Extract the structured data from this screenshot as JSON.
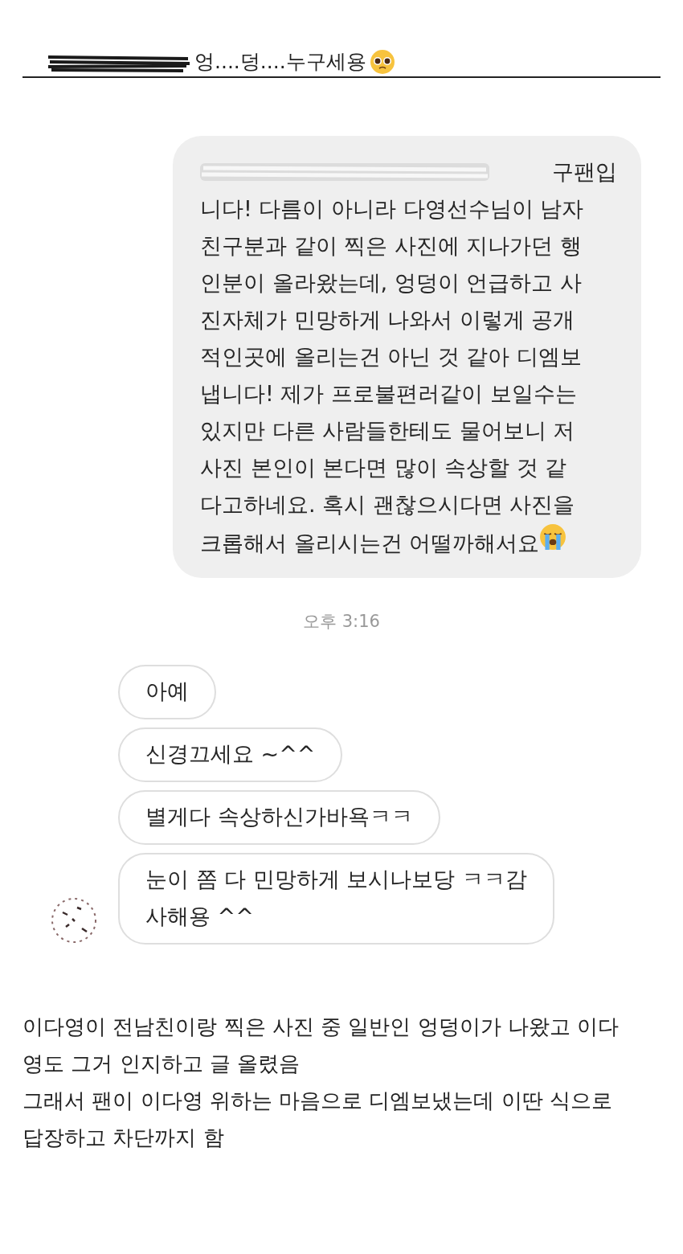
{
  "header": {
    "text": "엉....덩....누구세용"
  },
  "sent_message": {
    "lines": [
      "구팬입",
      "니다! 다름이 아니라 다영선수님이 남자",
      "친구분과 같이 찍은 사진에 지나가던 행",
      "인분이 올라왔는데, 엉덩이 언급하고 사",
      "진자체가 민망하게 나와서 이렇게 공개",
      "적인곳에 올리는건 아닌 것 같아 디엠보",
      "냅니다! 제가 프로불편러같이 보일수는",
      "있지만 다른 사람들한테도 물어보니 저",
      "사진 본인이 본다면 많이 속상할 것 같",
      "다고하네요. 혹시 괜찮으시다면 사진을",
      "크롭해서 올리시는건 어떨까해서요"
    ]
  },
  "timestamp": "오후 3:16",
  "received_messages": [
    {
      "lines": [
        "아예"
      ]
    },
    {
      "lines": [
        "신경끄세요 ~^^"
      ]
    },
    {
      "lines": [
        "별게다 속상하신가바욕ㅋㅋ"
      ]
    },
    {
      "lines": [
        "눈이 쫌 다 민망하게 보시나보당 ㅋㅋ감",
        "사해용 ^^"
      ]
    }
  ],
  "caption": [
    "이다영이 전남친이랑 찍은 사진 중 일반인 엉덩이가 나왔고 이다",
    "영도 그거 인지하고 글 올렸음",
    "그래서 팬이 이다영 위하는 마음으로 디엠보냈는데 이딴 식으로",
    "답장하고 차단까지 함"
  ]
}
